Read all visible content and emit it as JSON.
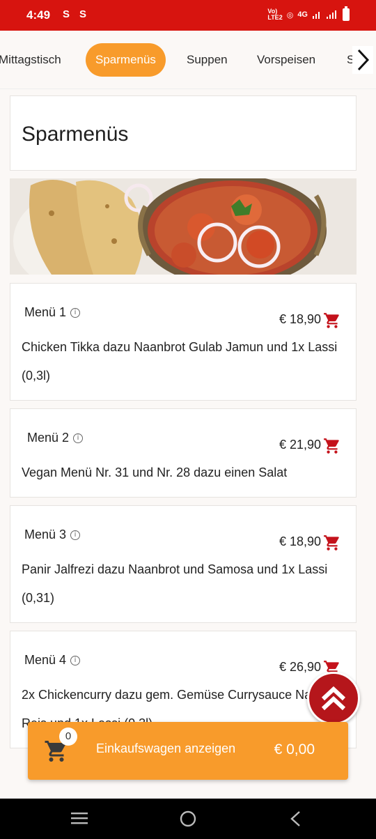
{
  "status": {
    "time": "4:49",
    "icons": [
      "S",
      "S"
    ],
    "net": "4G"
  },
  "tabs": [
    {
      "label": "Mittagstisch"
    },
    {
      "label": "Sparmenüs",
      "active": true
    },
    {
      "label": "Suppen"
    },
    {
      "label": "Vorspeisen"
    },
    {
      "label": "S"
    }
  ],
  "section": {
    "title": "Sparmenüs"
  },
  "items": [
    {
      "name": "Menü 1",
      "price": "€ 18,90",
      "desc": "Chicken Tikka dazu Naanbrot Gulab Jamun und 1x Lassi (0,3l)"
    },
    {
      "name": "Menü 2",
      "price": "€ 21,90",
      "desc": "Vegan Menü Nr. 31 und Nr. 28 dazu einen Salat"
    },
    {
      "name": "Menü 3",
      "price": "€ 18,90",
      "desc": "Panir Jalfrezi dazu Naanbrot und Samosa und 1x Lassi (0,31)"
    },
    {
      "name": "Menü 4",
      "price": "€ 26,90",
      "desc": "2x Chickencurry dazu gem. Gemüse Currysauce Naanbrot, Reis und 1x Lassi (0,3l)"
    }
  ],
  "cart": {
    "count": "0",
    "label": "Einkaufswagen anzeigen",
    "total": "€ 0,00"
  },
  "colors": {
    "brand_red": "#d7140f",
    "accent_orange": "#f89b2b",
    "fab_red": "#b5161b"
  }
}
